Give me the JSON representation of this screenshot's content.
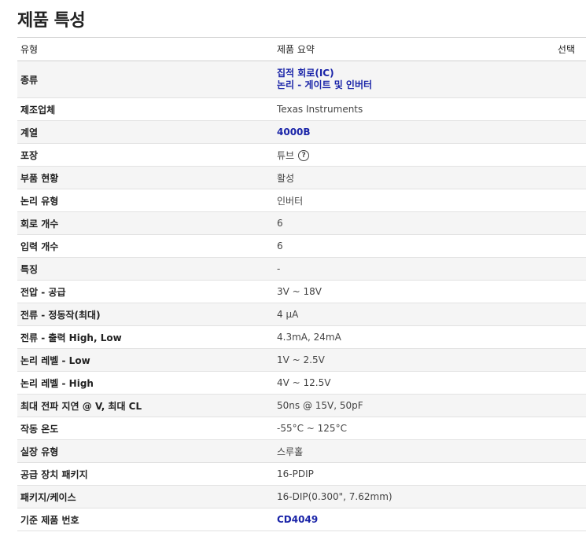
{
  "page": {
    "title": "제품 특성"
  },
  "header": {
    "type": "유형",
    "summary": "제품 요약",
    "select": "선택"
  },
  "rows": [
    {
      "label": "종류",
      "values": [
        "집적 회로(IC)",
        "논리 - 게이트 및 인버터"
      ],
      "link": true
    },
    {
      "label": "제조업체",
      "value": "Texas Instruments"
    },
    {
      "label": "계열",
      "value": "4000B",
      "link": true
    },
    {
      "label": "포장",
      "value": "튜브",
      "icon": "help-icon"
    },
    {
      "label": "부품 현황",
      "value": "활성"
    },
    {
      "label": "논리 유형",
      "value": "인버터"
    },
    {
      "label": "회로 개수",
      "value": "6"
    },
    {
      "label": "입력 개수",
      "value": "6"
    },
    {
      "label": "특징",
      "value": "-"
    },
    {
      "label": "전압 - 공급",
      "value": "3V ~ 18V"
    },
    {
      "label": "전류 - 정동작(최대)",
      "value": "4 µA"
    },
    {
      "label": "전류 - 출력 High, Low",
      "value": "4.3mA, 24mA"
    },
    {
      "label": "논리 레벨 - Low",
      "value": "1V ~ 2.5V"
    },
    {
      "label": "논리 레벨 - High",
      "value": "4V ~ 12.5V"
    },
    {
      "label": "최대 전파 지연 @ V, 최대 CL",
      "value": "50ns @ 15V, 50pF"
    },
    {
      "label": "작동 온도",
      "value": "-55°C ~ 125°C"
    },
    {
      "label": "실장 유형",
      "value": "스루홀"
    },
    {
      "label": "공급 장치 패키지",
      "value": "16-PDIP"
    },
    {
      "label": "패키지/케이스",
      "value": "16-DIP(0.300\", 7.62mm)"
    },
    {
      "label": "기준 제품 번호",
      "value": "CD4049",
      "link": true
    }
  ]
}
